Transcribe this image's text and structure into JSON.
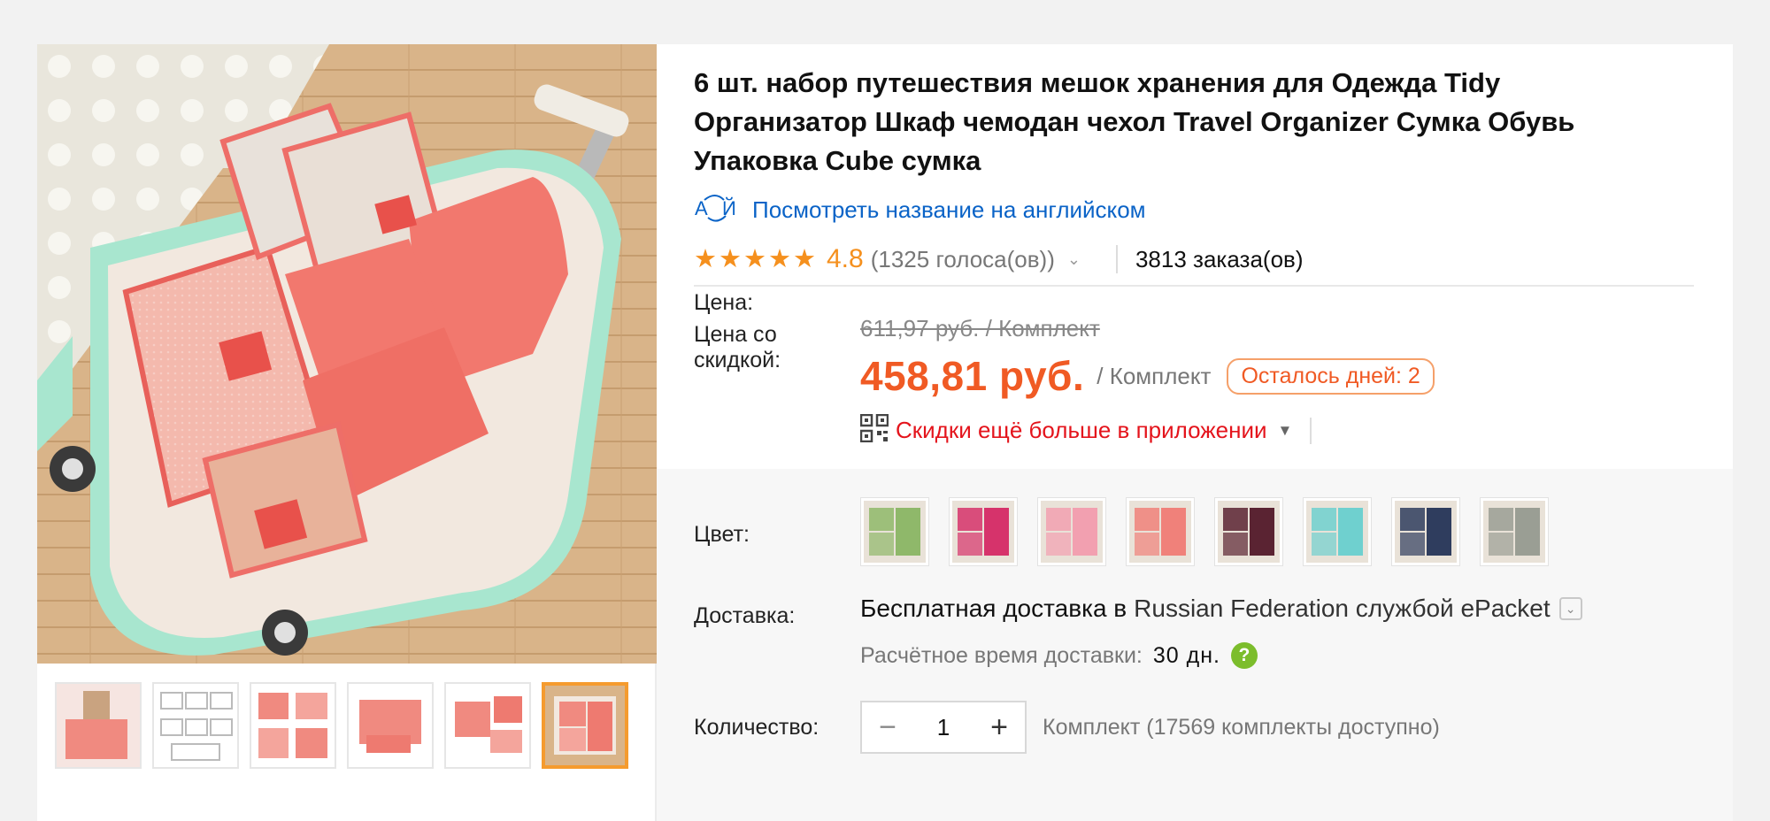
{
  "product": {
    "title": "6 шт. набор путешествия мешок хранения для Одежда Tidy Организатор Шкаф чемодан чехол Travel Organizer Сумка Обувь Упаковка Cube сумка",
    "translate_link": "Посмотреть название на английском",
    "translate_icon": "translate-icon",
    "rating_value": "4.8",
    "rating_stars": 5,
    "votes": "(1325 голоса(ов))",
    "orders": "3813 заказа(ов)"
  },
  "pricing": {
    "price_label": "Цена:",
    "old_price": "611,97 руб. / Комплект",
    "discount_label": "Цена со скидкой:",
    "price": "458,81 руб.",
    "unit": "/ Комплект",
    "days_left": "Осталось дней: 2",
    "app_discount": "Скидки ещё больше в приложении"
  },
  "options": {
    "color_label": "Цвет:",
    "swatch_colors": [
      "#8fb86a",
      "#d6336b",
      "#f2a0b0",
      "#f0817a",
      "#5a2332",
      "#6fd0cf",
      "#2f3d5e",
      "#9a9e94"
    ]
  },
  "shipping": {
    "label": "Доставка:",
    "free_text": "Бесплатная доставка в",
    "destination": "Russian Federation службой ePacket",
    "eta_label": "Расчётное время доставки:",
    "eta_value": "30 дн.",
    "help_glyph": "?"
  },
  "quantity": {
    "label": "Количество:",
    "value": "1",
    "minus": "−",
    "plus": "+",
    "stock": "Комплект (17569 комплекты доступно)"
  },
  "colors": {
    "accent": "#f05a24",
    "link": "#0a63c7",
    "star": "#f5901e",
    "app_red": "#e4141c",
    "active_thumb": "#f59b2e"
  }
}
